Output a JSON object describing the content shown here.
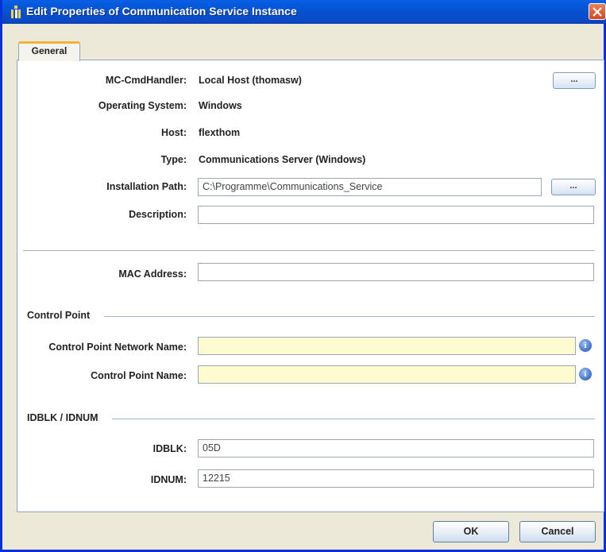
{
  "window": {
    "title": "Edit Properties of Communication Service Instance"
  },
  "tabs": [
    {
      "label": "General"
    }
  ],
  "general": {
    "cmd_handler": {
      "label": "MC-CmdHandler:",
      "value": "Local Host (thomasw)",
      "button": "..."
    },
    "os": {
      "label": "Operating System:",
      "value": "Windows"
    },
    "host": {
      "label": "Host:",
      "value": "flexthom"
    },
    "type": {
      "label": "Type:",
      "value": "Communications Server (Windows)"
    },
    "installation_path": {
      "label": "Installation Path:",
      "value": "C:\\Programme\\Communications_Service",
      "button": "..."
    },
    "description": {
      "label": "Description:",
      "value": ""
    },
    "mac_address": {
      "label": "MAC Address:",
      "value": ""
    }
  },
  "control_point": {
    "title": "Control Point",
    "network_name": {
      "label": "Control Point Network Name:",
      "value": ""
    },
    "name": {
      "label": "Control Point Name:",
      "value": ""
    },
    "info_icon": "info-icon"
  },
  "idblk_idnum": {
    "title": "IDBLK / IDNUM",
    "idblk": {
      "label": "IDBLK:",
      "value": "05D"
    },
    "idnum": {
      "label": "IDNUM:",
      "value": "12215"
    }
  },
  "buttons": {
    "ok": "OK",
    "cancel": "Cancel"
  },
  "colors": {
    "titlebar": "#0454d4",
    "required_field": "#fffbd0",
    "close_button": "#d4481e"
  }
}
